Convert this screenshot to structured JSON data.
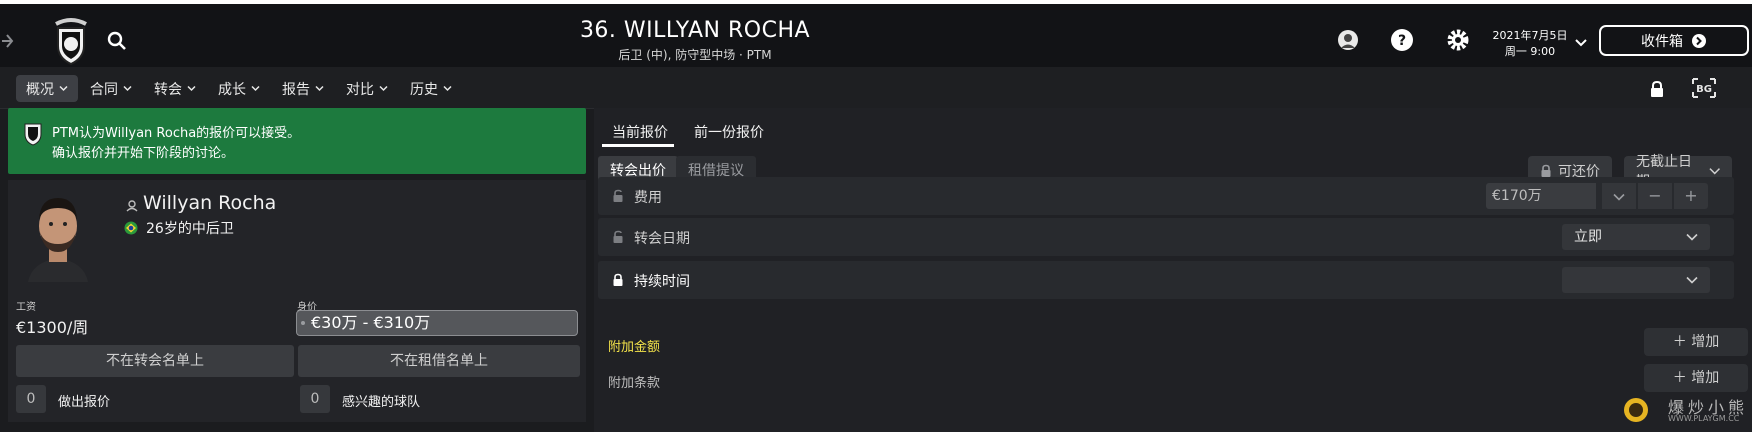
{
  "header": {
    "title": "36. WILLYAN ROCHA",
    "subtitle": "后卫 (中), 防守型中场 · PTM",
    "date_line1": "2021年7月5日",
    "date_line2": "周一 9:00",
    "inbox_label": "收件箱"
  },
  "menu": [
    {
      "label": "概况"
    },
    {
      "label": "合同"
    },
    {
      "label": "转会"
    },
    {
      "label": "成长"
    },
    {
      "label": "报告"
    },
    {
      "label": "对比"
    },
    {
      "label": "历史"
    }
  ],
  "notice": {
    "line1": "PTM认为Willyan Rocha的报价可以接受。",
    "line2": "确认报价并开始下阶段的讨论。"
  },
  "player": {
    "name": "Willyan Rocha",
    "age_position": "26岁的中后卫",
    "wage_label": "工资",
    "wage": "€1300/周",
    "value_label": "身价",
    "value": "€30万 - €310万",
    "transfer_list": "不在转会名单上",
    "loan_list": "不在租借名单上",
    "offers_count": "0",
    "offers_label": "做出报价",
    "interested_count": "0",
    "interested_label": "感兴趣的球队"
  },
  "offer": {
    "tab_current": "当前报价",
    "tab_previous": "前一份报价",
    "subtab_transfer": "转会出价",
    "subtab_loan": "租借提议",
    "negotiable": "可还价",
    "deadline": "无截止日期",
    "fee_label": "费用",
    "fee_value": "€170万",
    "fee_btn_down": "−",
    "fee_btn_up": "+",
    "date_label": "转会日期",
    "date_value": "立即",
    "duration_label": "持续时间",
    "duration_value": "",
    "addon_fee_label": "附加金额",
    "addon_clause_label": "附加条款",
    "add_label": "增加"
  },
  "watermark": {
    "text": "爆炒小熊",
    "sub": "WWW.PLAYGM.CC"
  },
  "colors": {
    "notice_green": "#1d7a3e",
    "addon_fee_yellow": "#f3e24a"
  }
}
